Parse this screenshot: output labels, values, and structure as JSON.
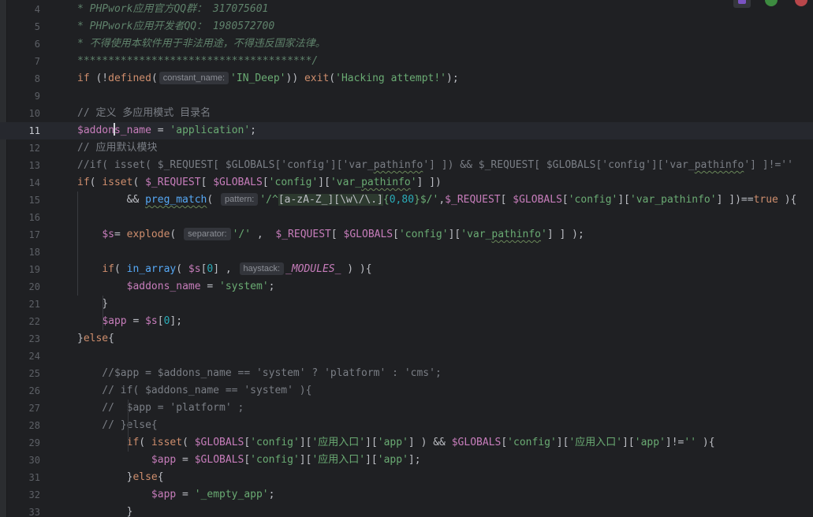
{
  "editor": {
    "current_line": "11",
    "lines": [
      {
        "no": "4",
        "segs": [
          [
            "doc",
            "* PHPwork应用官方QQ群： 317075601"
          ]
        ]
      },
      {
        "no": "5",
        "segs": [
          [
            "doc",
            "* PHPwork应用开发者QQ： 1980572700"
          ]
        ]
      },
      {
        "no": "6",
        "segs": [
          [
            "doc",
            "* 不得使用本软件用于非法用途，不得违反国家法律。"
          ]
        ]
      },
      {
        "no": "7",
        "segs": [
          [
            "doc",
            "**************************************/"
          ]
        ]
      },
      {
        "no": "8",
        "segs": [
          [
            "kw",
            "if"
          ],
          [
            "p",
            " (!"
          ],
          [
            "kw",
            "defined"
          ],
          [
            "p",
            "("
          ],
          [
            "hint",
            "constant_name:"
          ],
          [
            "str",
            "'IN_Deep'"
          ],
          [
            "p",
            ")) "
          ],
          [
            "kw",
            "exit"
          ],
          [
            "p",
            "("
          ],
          [
            "str",
            "'Hacking attempt!'"
          ],
          [
            "p",
            ");"
          ]
        ]
      },
      {
        "no": "9",
        "segs": []
      },
      {
        "no": "10",
        "segs": [
          [
            "cm",
            "// 定义 多应用模式 目录名"
          ]
        ]
      },
      {
        "no": "11",
        "segs": [
          [
            "var",
            "$addon"
          ],
          [
            "caret",
            ""
          ],
          [
            "var",
            "s_name"
          ],
          [
            "p",
            " = "
          ],
          [
            "str",
            "'application'"
          ],
          [
            "p",
            ";"
          ]
        ]
      },
      {
        "no": "12",
        "segs": [
          [
            "cm",
            "// 应用默认模块"
          ]
        ]
      },
      {
        "no": "13",
        "segs": [
          [
            "cm",
            "//if( isset( $_REQUEST[ $GLOBALS['config']['var_"
          ],
          [
            "cmu",
            "pathinfo"
          ],
          [
            "cm",
            "'] ]) && $_REQUEST[ $GLOBALS['config']['var_"
          ],
          [
            "cmu",
            "pathinfo"
          ],
          [
            "cm",
            "'] ]!=''"
          ]
        ]
      },
      {
        "no": "14",
        "segs": [
          [
            "kw",
            "if"
          ],
          [
            "p",
            "( "
          ],
          [
            "kw",
            "isset"
          ],
          [
            "p",
            "( "
          ],
          [
            "gl",
            "$_REQUEST"
          ],
          [
            "p",
            "[ "
          ],
          [
            "gl",
            "$GLOBALS"
          ],
          [
            "p",
            "["
          ],
          [
            "str",
            "'config'"
          ],
          [
            "p",
            "]["
          ],
          [
            "str",
            "'var_"
          ],
          [
            "stru",
            "pathinfo"
          ],
          [
            "str",
            "'"
          ],
          [
            "p",
            "] ])"
          ]
        ]
      },
      {
        "no": "15",
        "segs": [
          [
            "p",
            "        && "
          ],
          [
            "fnu",
            "preg_match"
          ],
          [
            "p",
            "( "
          ],
          [
            "hint",
            "pattern:"
          ],
          [
            "str",
            "'/^"
          ],
          [
            "rxb",
            "[a-zA-Z_][\\w\\/\\.]"
          ],
          [
            "rx",
            "{"
          ],
          [
            "num",
            "0,80"
          ],
          [
            "rx",
            "}"
          ],
          [
            "str",
            "$/'"
          ],
          [
            "p",
            ","
          ],
          [
            "gl",
            "$_REQUEST"
          ],
          [
            "p",
            "[ "
          ],
          [
            "gl",
            "$GLOBALS"
          ],
          [
            "p",
            "["
          ],
          [
            "str",
            "'config'"
          ],
          [
            "p",
            "]["
          ],
          [
            "str",
            "'var_pathinfo'"
          ],
          [
            "p",
            "] ])=="
          ],
          [
            "kw",
            "true"
          ],
          [
            "p",
            " ){"
          ]
        ]
      },
      {
        "no": "16",
        "segs": []
      },
      {
        "no": "17",
        "segs": [
          [
            "p",
            "    "
          ],
          [
            "var",
            "$s"
          ],
          [
            "p",
            "= "
          ],
          [
            "kw",
            "explode"
          ],
          [
            "p",
            "( "
          ],
          [
            "hint",
            "separator:"
          ],
          [
            "str",
            "'/'"
          ],
          [
            "p",
            " ,  "
          ],
          [
            "gl",
            "$_REQUEST"
          ],
          [
            "p",
            "[ "
          ],
          [
            "gl",
            "$GLOBALS"
          ],
          [
            "p",
            "["
          ],
          [
            "str",
            "'config'"
          ],
          [
            "p",
            "]["
          ],
          [
            "str",
            "'var_"
          ],
          [
            "stru",
            "pathinfo"
          ],
          [
            "str",
            "'"
          ],
          [
            "p",
            "] ] );"
          ]
        ]
      },
      {
        "no": "18",
        "segs": []
      },
      {
        "no": "19",
        "segs": [
          [
            "p",
            "    "
          ],
          [
            "kw",
            "if"
          ],
          [
            "p",
            "( "
          ],
          [
            "fn",
            "in_array"
          ],
          [
            "p",
            "( "
          ],
          [
            "var",
            "$s"
          ],
          [
            "p",
            "["
          ],
          [
            "num",
            "0"
          ],
          [
            "p",
            "] , "
          ],
          [
            "hint",
            "haystack:"
          ],
          [
            "cst",
            "_MODULES_"
          ],
          [
            "p",
            " ) ){"
          ]
        ]
      },
      {
        "no": "20",
        "segs": [
          [
            "p",
            "        "
          ],
          [
            "var",
            "$addons_name"
          ],
          [
            "p",
            " = "
          ],
          [
            "str",
            "'system'"
          ],
          [
            "p",
            ";"
          ]
        ]
      },
      {
        "no": "21",
        "segs": [
          [
            "p",
            "    }"
          ]
        ]
      },
      {
        "no": "22",
        "segs": [
          [
            "p",
            "    "
          ],
          [
            "var",
            "$app"
          ],
          [
            "p",
            " = "
          ],
          [
            "var",
            "$s"
          ],
          [
            "p",
            "["
          ],
          [
            "num",
            "0"
          ],
          [
            "p",
            "];"
          ]
        ]
      },
      {
        "no": "23",
        "segs": [
          [
            "p",
            "}"
          ],
          [
            "kw",
            "else"
          ],
          [
            "p",
            "{"
          ]
        ]
      },
      {
        "no": "24",
        "segs": []
      },
      {
        "no": "25",
        "segs": [
          [
            "cm",
            "    //$app = $addons_name == 'system' ? 'platform' : 'cms';"
          ]
        ]
      },
      {
        "no": "26",
        "segs": [
          [
            "cm",
            "    // if( $addons_name == 'system' ){"
          ]
        ]
      },
      {
        "no": "27",
        "segs": [
          [
            "cm",
            "    //  $app = 'platform' ;"
          ]
        ]
      },
      {
        "no": "28",
        "segs": [
          [
            "cm",
            "    // }else{"
          ]
        ]
      },
      {
        "no": "29",
        "segs": [
          [
            "p",
            "        "
          ],
          [
            "kw",
            "if"
          ],
          [
            "p",
            "( "
          ],
          [
            "kw",
            "isset"
          ],
          [
            "p",
            "( "
          ],
          [
            "gl",
            "$GLOBALS"
          ],
          [
            "p",
            "["
          ],
          [
            "str",
            "'config'"
          ],
          [
            "p",
            "]["
          ],
          [
            "str",
            "'应用入口'"
          ],
          [
            "p",
            "]["
          ],
          [
            "str",
            "'app'"
          ],
          [
            "p",
            "] ) && "
          ],
          [
            "gl",
            "$GLOBALS"
          ],
          [
            "p",
            "["
          ],
          [
            "str",
            "'config'"
          ],
          [
            "p",
            "]["
          ],
          [
            "str",
            "'应用入口'"
          ],
          [
            "p",
            "]["
          ],
          [
            "str",
            "'app'"
          ],
          [
            "p",
            "]!="
          ],
          [
            "str",
            "''"
          ],
          [
            "p",
            " ){"
          ]
        ]
      },
      {
        "no": "30",
        "segs": [
          [
            "p",
            "            "
          ],
          [
            "var",
            "$app"
          ],
          [
            "p",
            " = "
          ],
          [
            "gl",
            "$GLOBALS"
          ],
          [
            "p",
            "["
          ],
          [
            "str",
            "'config'"
          ],
          [
            "p",
            "]["
          ],
          [
            "str",
            "'应用入口'"
          ],
          [
            "p",
            "]["
          ],
          [
            "str",
            "'app'"
          ],
          [
            "p",
            "];"
          ]
        ]
      },
      {
        "no": "31",
        "segs": [
          [
            "p",
            "        }"
          ],
          [
            "kw",
            "else"
          ],
          [
            "p",
            "{"
          ]
        ]
      },
      {
        "no": "32",
        "segs": [
          [
            "p",
            "            "
          ],
          [
            "var",
            "$app"
          ],
          [
            "p",
            " = "
          ],
          [
            "str",
            "'_empty_app'"
          ],
          [
            "p",
            ";"
          ]
        ]
      },
      {
        "no": "33",
        "segs": [
          [
            "p",
            "        }"
          ]
        ]
      }
    ]
  },
  "colors": {
    "background": "#1f2023",
    "comment": "#7a7e85",
    "doc_comment": "#5f826b",
    "keyword": "#cf8e6d",
    "function": "#56a8f5",
    "string": "#6aab73",
    "variable": "#c77dbb",
    "number": "#2aacb8"
  },
  "icons": [
    "plugin-icon",
    "chrome-icon",
    "browser-icon"
  ]
}
